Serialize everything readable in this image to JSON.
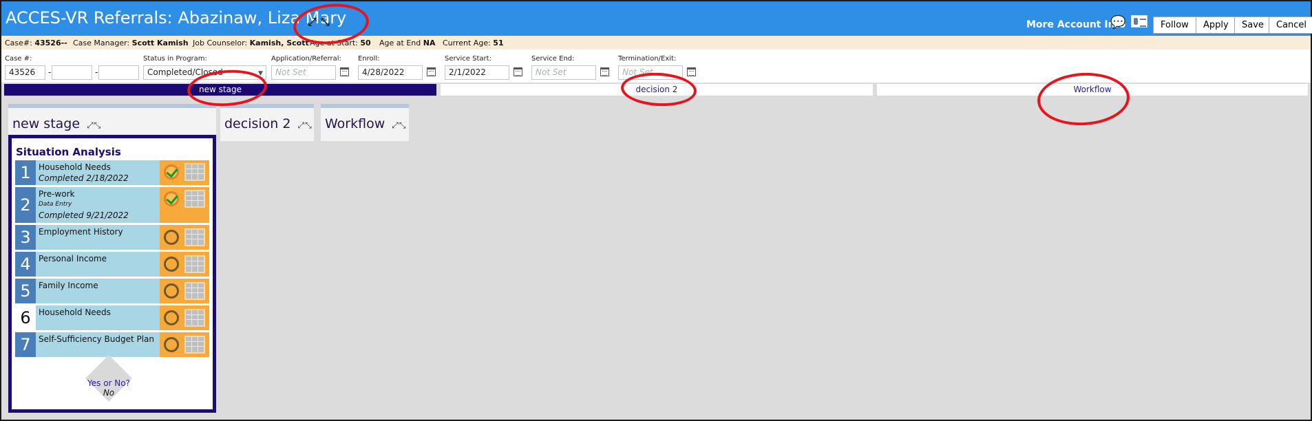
{
  "header": {
    "title": "ACCES-VR Referrals: Abazinaw, Liza Mary",
    "more_info": "More Account Info",
    "buttons": {
      "follow": "Follow",
      "apply": "Apply",
      "save": "Save",
      "cancel": "Cancel"
    },
    "accent": "#2f8fe6"
  },
  "case_info": {
    "case_label": "Case#:",
    "case_value": "43526--",
    "manager_label": "Case Manager:",
    "manager_value": "Scott Kamish",
    "counselor_label": "Job Counselor:",
    "counselor_value": "Kamish, Scott",
    "age_start_label": "Age at Start:",
    "age_start_value": "50",
    "age_end_label": "Age at End",
    "age_end_value": "NA",
    "current_age_label": "Current Age:",
    "current_age_value": "51"
  },
  "fields": {
    "case_no_label": "Case #:",
    "case_no_value": "43526",
    "status_label": "Status in Program:",
    "status_value": "Completed/Closed",
    "application_label": "Application/Referral:",
    "application_placeholder": "Not Set",
    "enroll_label": "Enroll:",
    "enroll_value": "4/28/2022",
    "service_start_label": "Service Start:",
    "service_start_value": "2/1/2022",
    "service_end_label": "Service End:",
    "service_end_placeholder": "Not Set",
    "termination_label": "Termination/Exit:",
    "termination_placeholder": "Not Set"
  },
  "stages": [
    {
      "label": "new stage",
      "active": true
    },
    {
      "label": "decision 2",
      "active": false
    },
    {
      "label": "Workflow",
      "active": false
    }
  ],
  "panels": [
    {
      "title": "new stage"
    },
    {
      "title": "decision 2"
    },
    {
      "title": "Workflow"
    }
  ],
  "situation": {
    "title": "Situation Analysis",
    "tasks": [
      {
        "num": "1",
        "name": "Household Needs",
        "completed": "Completed 2/18/2022",
        "done": true
      },
      {
        "num": "2",
        "name": "Pre-work",
        "sub": "Data Entry",
        "completed": "Completed 9/21/2022",
        "done": true
      },
      {
        "num": "3",
        "name": "Employment History",
        "done": false
      },
      {
        "num": "4",
        "name": "Personal Income",
        "done": false
      },
      {
        "num": "5",
        "name": "Family Income",
        "done": false
      },
      {
        "num": "6",
        "name": "Household Needs",
        "done": false
      },
      {
        "num": "7",
        "name": "Self-Sufficiency Budget Plan",
        "done": false
      }
    ],
    "decision": {
      "question": "Yes or No?",
      "answer": "No"
    }
  }
}
